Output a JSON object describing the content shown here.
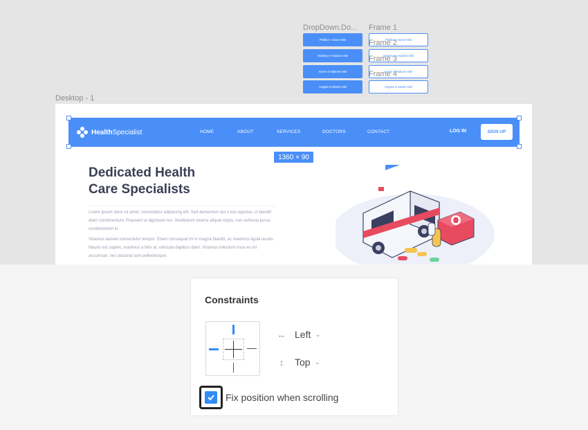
{
  "canvas": {
    "dropdown_frame_label": "DropDown.Do...",
    "desktop_frame_label": "Desktop - 1",
    "frame_labels": [
      "Frame 1",
      "Frame 2",
      "Frame 3",
      "Frame 4"
    ],
    "dropdown_items": [
      "Phillis K Vance MD",
      "Stanley K Hudson MD",
      "Kevin D Malone MD",
      "Angela S Martin MD"
    ],
    "frame_items": [
      "Phillis K Vance MD",
      "Stanley K Hudson MD",
      "Kevin D Malone MD",
      "Angela S Martin MD"
    ],
    "size_badge": "1360 × 90",
    "accent_color": "#4a8ff7"
  },
  "site": {
    "logo_bold": "Health",
    "logo_rest": "Specialist",
    "nav": [
      "HOME",
      "ABOUT",
      "SERVICES",
      "DOCTORS",
      "CONTACT"
    ],
    "login": "LOG IN",
    "signup": "SIGN UP",
    "hero_title_line1": "Dedicated Health",
    "hero_title_line2": "Care Specialists",
    "hero_para1": "Lorem ipsum dolor sit amet, consectetur adipiscing elit. Sed dementum dui s eos egestas, in blandit diam condimentum. Praesent ut dignissim leo. Vestibulum viverra aliquet turpis, non vehicula purus condimentum in.",
    "hero_para2": "Vivamus laoreet consectetur tempor. Etiam consequat mi in magna blandit, ac maximus ligula iaculis. Mauris est sapien, maximus a felis at, vehicula dapibus diam. Vivamus interdum risus eu mi accumsan, nec placerat sem pellentesque."
  },
  "constraints": {
    "title": "Constraints",
    "horizontal_icon": "horizontal-arrows-icon",
    "horizontal_value": "Left",
    "vertical_icon": "vertical-arrows-icon",
    "vertical_value": "Top",
    "fix_label": "Fix position when scrolling",
    "fix_checked": true,
    "checkbox_color": "#2f8cf5"
  }
}
